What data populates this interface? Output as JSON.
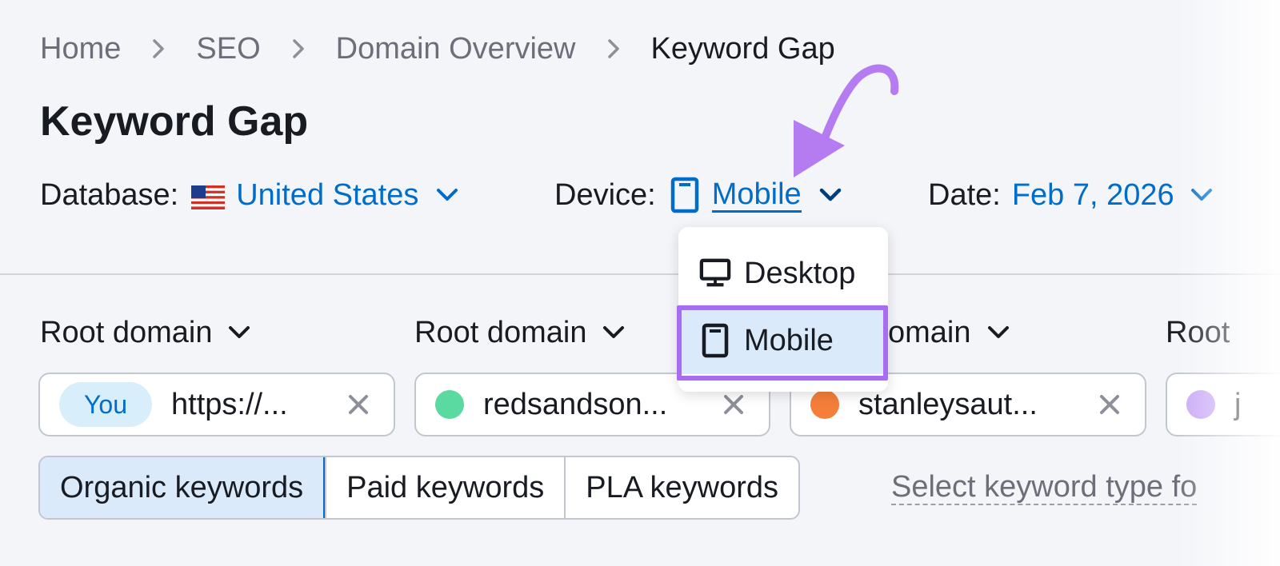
{
  "breadcrumb": {
    "items": [
      "Home",
      "SEO",
      "Domain Overview"
    ],
    "current": "Keyword Gap"
  },
  "page_title": "Keyword Gap",
  "filters": {
    "database_label": "Database:",
    "database_value": "United States",
    "device_label": "Device:",
    "device_value": "Mobile",
    "date_label": "Date:",
    "date_value": "Feb 7, 2026"
  },
  "device_dropdown": {
    "options": [
      "Desktop",
      "Mobile"
    ],
    "selected": "Mobile"
  },
  "competitors": [
    {
      "label": "Root domain",
      "badge": "You",
      "value": "https://..."
    },
    {
      "label": "Root domain",
      "value": "redsandson...",
      "color": "#5ad9a1"
    },
    {
      "label": "Root domain",
      "value": "stanleysaut...",
      "color": "#f47e3a"
    },
    {
      "label": "Root",
      "value": "j",
      "color": "#c9a8f7"
    }
  ],
  "root_domain_partial": "omain",
  "keyword_tabs": [
    "Organic keywords",
    "Paid keywords",
    "PLA keywords"
  ],
  "keyword_tab_active": "Organic keywords",
  "keyword_type_hint": "Select keyword type fo",
  "colors": {
    "accent": "#006dca",
    "highlight": "#a86bf1",
    "arrow": "#b57bf0"
  },
  "icons": [
    "chevron-right-icon",
    "us-flag-icon",
    "chevron-down-icon",
    "mobile-icon",
    "desktop-icon",
    "close-icon",
    "annotation-arrow-icon"
  ]
}
